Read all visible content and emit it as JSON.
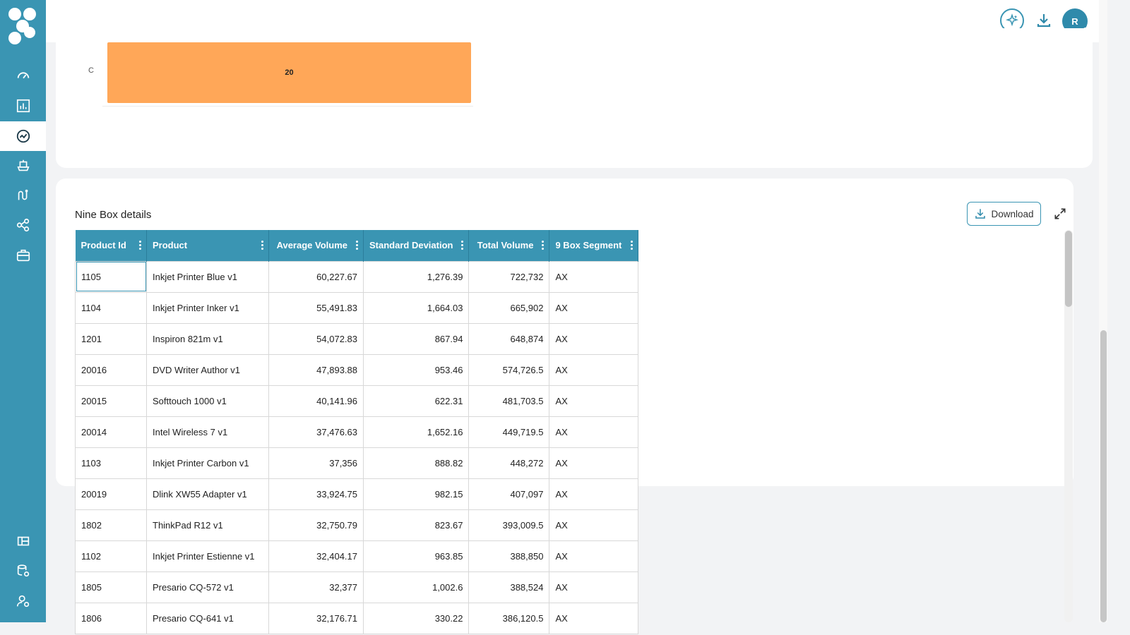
{
  "app": {
    "logo_icon": "petal-logo-icon",
    "accent_color": "#3a95b3"
  },
  "sidebar": {
    "items": [
      {
        "icon": "gauge-icon",
        "active": false
      },
      {
        "icon": "report-chart-icon",
        "active": false
      },
      {
        "icon": "trend-circle-icon",
        "active": true
      },
      {
        "icon": "ship-icon",
        "active": false
      },
      {
        "icon": "route-icon",
        "active": false
      },
      {
        "icon": "network-icon",
        "active": false
      },
      {
        "icon": "briefcase-icon",
        "active": false
      }
    ],
    "bottom_items": [
      {
        "icon": "dashboard-grid-icon"
      },
      {
        "icon": "database-settings-icon"
      },
      {
        "icon": "user-settings-icon"
      }
    ]
  },
  "topbar": {
    "ai_icon": "sparkle-ai-icon",
    "download_icon": "download-icon",
    "avatar_initial": "R",
    "avatar_status": "online"
  },
  "chart_data": {
    "type": "bar",
    "orientation": "horizontal",
    "categories": [
      "C"
    ],
    "values": [
      20
    ],
    "bar_color": "#ffa758",
    "data_labels": [
      "20"
    ]
  },
  "details": {
    "title": "Nine Box details",
    "download_label": "Download",
    "expand_icon": "expand-icon",
    "columns": [
      "Product Id",
      "Product",
      "Average Volume",
      "Standard Deviation",
      "Total Volume",
      "9 Box Segment"
    ],
    "rows": [
      [
        "1105",
        "Inkjet Printer Blue v1",
        "60,227.67",
        "1,276.39",
        "722,732",
        "AX"
      ],
      [
        "1104",
        "Inkjet Printer Inker v1",
        "55,491.83",
        "1,664.03",
        "665,902",
        "AX"
      ],
      [
        "1201",
        "Inspiron 821m v1",
        "54,072.83",
        "867.94",
        "648,874",
        "AX"
      ],
      [
        "20016",
        "DVD Writer Author v1",
        "47,893.88",
        "953.46",
        "574,726.5",
        "AX"
      ],
      [
        "20015",
        "Softtouch 1000 v1",
        "40,141.96",
        "622.31",
        "481,703.5",
        "AX"
      ],
      [
        "20014",
        "Intel Wireless 7 v1",
        "37,476.63",
        "1,652.16",
        "449,719.5",
        "AX"
      ],
      [
        "1103",
        "Inkjet Printer Carbon v1",
        "37,356",
        "888.82",
        "448,272",
        "AX"
      ],
      [
        "20019",
        "Dlink XW55 Adapter v1",
        "33,924.75",
        "982.15",
        "407,097",
        "AX"
      ],
      [
        "1802",
        "ThinkPad R12 v1",
        "32,750.79",
        "823.67",
        "393,009.5",
        "AX"
      ],
      [
        "1102",
        "Inkjet Printer Estienne v1",
        "32,404.17",
        "963.85",
        "388,850",
        "AX"
      ],
      [
        "1805",
        "Presario CQ-572 v1",
        "32,377",
        "1,002.6",
        "388,524",
        "AX"
      ],
      [
        "1806",
        "Presario CQ-641 v1",
        "32,176.71",
        "330.22",
        "386,120.5",
        "AX"
      ]
    ]
  }
}
